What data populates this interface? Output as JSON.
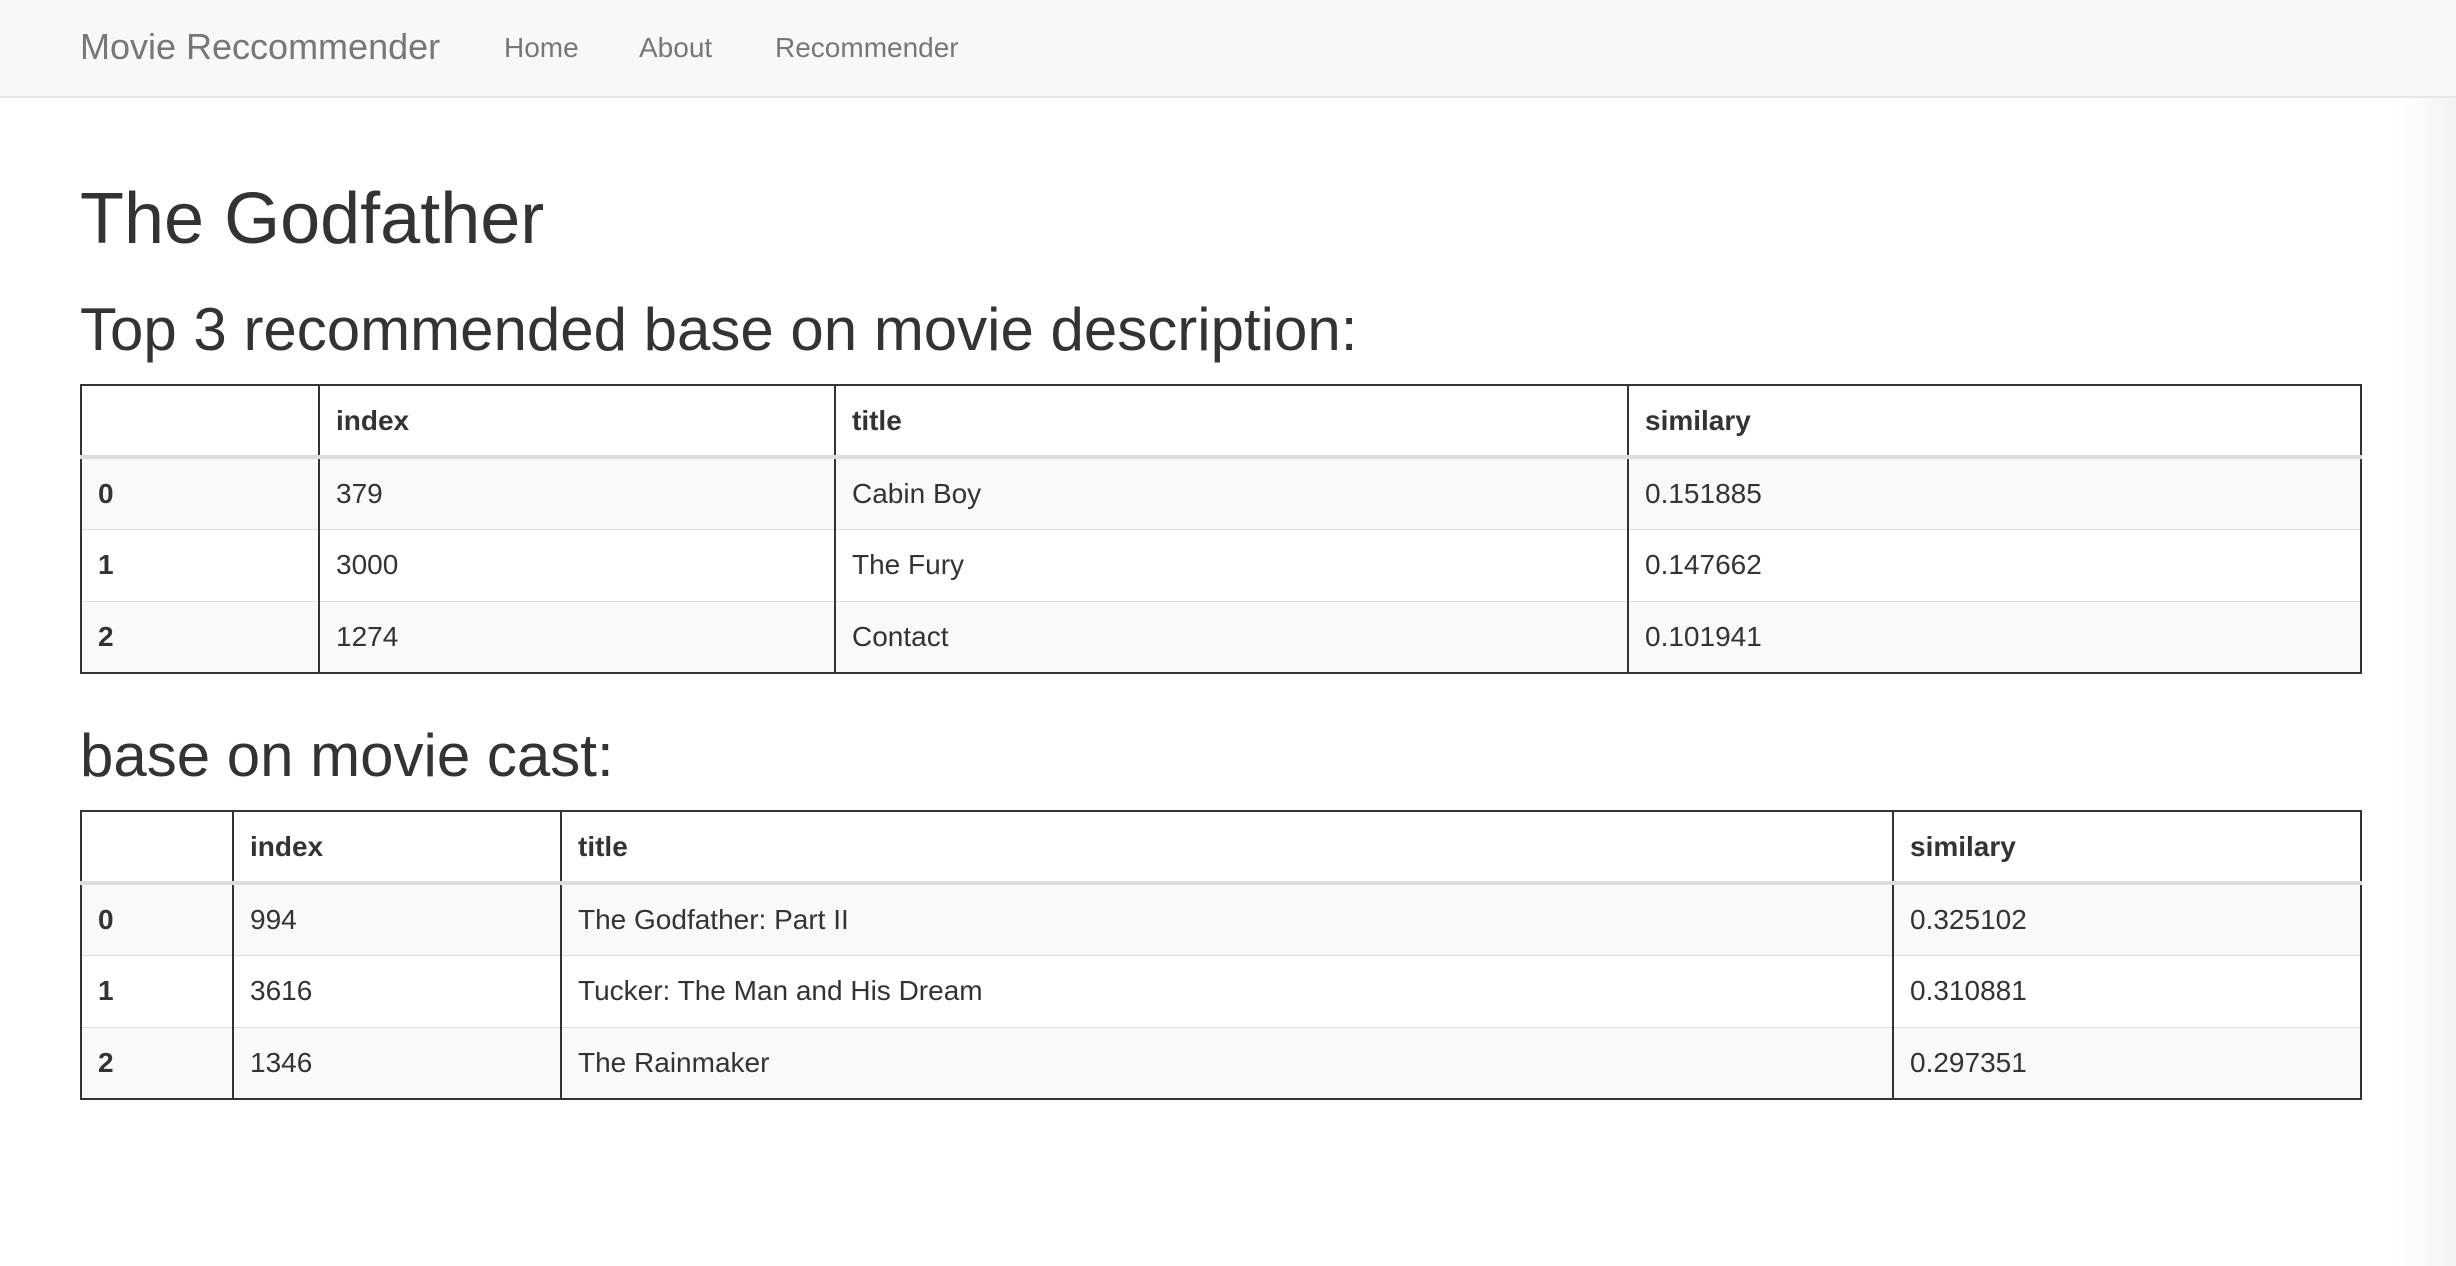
{
  "navbar": {
    "brand": "Movie Reccommender",
    "links": [
      "Home",
      "About",
      "Recommender"
    ]
  },
  "page": {
    "title": "The Godfather"
  },
  "description_section": {
    "heading": "Top 3 recommended base on movie description:",
    "columns": [
      "",
      "index",
      "title",
      "similary"
    ],
    "rows": [
      {
        "row": "0",
        "index": "379",
        "title": "Cabin Boy",
        "similary": "0.151885"
      },
      {
        "row": "1",
        "index": "3000",
        "title": "The Fury",
        "similary": "0.147662"
      },
      {
        "row": "2",
        "index": "1274",
        "title": "Contact",
        "similary": "0.101941"
      }
    ]
  },
  "cast_section": {
    "heading": "base on movie cast:",
    "columns": [
      "",
      "index",
      "title",
      "similary"
    ],
    "rows": [
      {
        "row": "0",
        "index": "994",
        "title": "The Godfather: Part II",
        "similary": "0.325102"
      },
      {
        "row": "1",
        "index": "3616",
        "title": "Tucker: The Man and His Dream",
        "similary": "0.310881"
      },
      {
        "row": "2",
        "index": "1346",
        "title": "The Rainmaker",
        "similary": "0.297351"
      }
    ]
  }
}
